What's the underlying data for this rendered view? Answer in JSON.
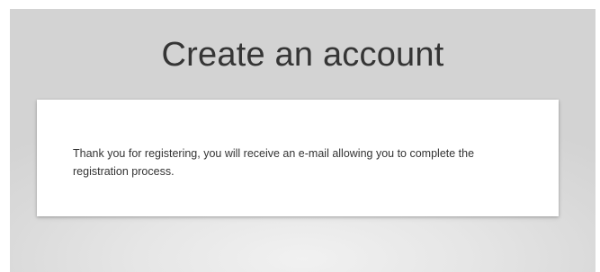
{
  "page": {
    "title": "Create an account"
  },
  "card": {
    "message": "Thank you for registering, you will receive an e-mail allowing you to complete the registration process."
  },
  "colors": {
    "background": "#d9d9d9",
    "card": "#ffffff",
    "title_text": "#353535",
    "body_text": "#333333"
  }
}
